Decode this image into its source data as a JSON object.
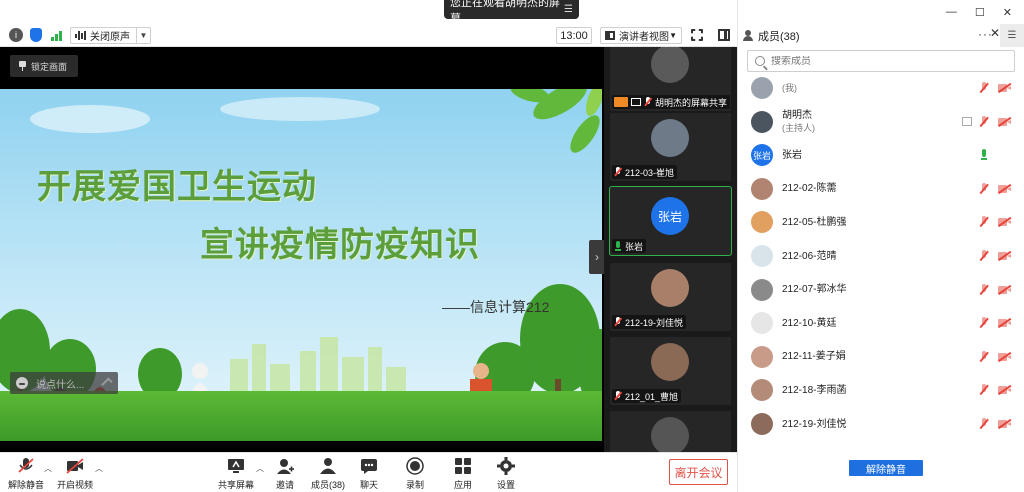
{
  "banner": {
    "viewing_text": "您正在观看胡明杰的屏幕"
  },
  "toolbar": {
    "audio_label": "关闭原声",
    "time": "13:00",
    "view_label": "演讲者视图"
  },
  "share": {
    "lock_label": "锁定画面",
    "slide_title_line1": "开展爱国卫生运动",
    "slide_title_line2": "宣讲疫情防疫知识",
    "slide_subtitle": "——信息计算212",
    "chat_placeholder": "说点什么..."
  },
  "thumbnails": [
    {
      "name": "胡明杰的屏幕共享",
      "audio": "muted",
      "sharing": true
    },
    {
      "name": "212-03-崔旭",
      "audio": "muted"
    },
    {
      "name": "张岩",
      "audio": "on",
      "initial": "张岩",
      "speaking": true
    },
    {
      "name": "212-19-刘佳悦",
      "audio": "muted"
    },
    {
      "name": "212_01_曹旭",
      "audio": "muted"
    }
  ],
  "bottom": {
    "unmute_label": "解除静音",
    "video_label": "开启视频",
    "share_label": "共享屏幕",
    "invite_label": "邀请",
    "members_label": "成员(38)",
    "chat_label": "聊天",
    "record_label": "录制",
    "apps_label": "应用",
    "settings_label": "设置",
    "leave_label": "离开会议"
  },
  "panel": {
    "title": "成员(38)",
    "search_placeholder": "搜索成员",
    "unmute_all_label": "解除静音",
    "members": [
      {
        "name": "",
        "role": "(我)",
        "mic": "off",
        "cam": "off"
      },
      {
        "name": "胡明杰",
        "role": "(主持人)",
        "mic": "off",
        "cam": "off",
        "screen": true
      },
      {
        "name": "张岩",
        "role": "",
        "mic": "on",
        "cam": "none",
        "initial": "张岩"
      },
      {
        "name": "212-02-陈薷",
        "role": "",
        "mic": "off",
        "cam": "off"
      },
      {
        "name": "212-05-杜鹏强",
        "role": "",
        "mic": "off",
        "cam": "off"
      },
      {
        "name": "212-06-范晴",
        "role": "",
        "mic": "off",
        "cam": "off"
      },
      {
        "name": "212-07-郭冰华",
        "role": "",
        "mic": "off",
        "cam": "off"
      },
      {
        "name": "212-10-黄廷",
        "role": "",
        "mic": "off",
        "cam": "off"
      },
      {
        "name": "212-11-姜子娟",
        "role": "",
        "mic": "off",
        "cam": "off"
      },
      {
        "name": "212-18-李雨菡",
        "role": "",
        "mic": "off",
        "cam": "off"
      },
      {
        "name": "212-19-刘佳悦",
        "role": "",
        "mic": "off",
        "cam": "off"
      }
    ]
  },
  "colors": {
    "accent_blue": "#1e6fe0",
    "leave_red": "#e3524a",
    "speaking_green": "#2db34a",
    "slide_title_green": "#5c9e3c"
  }
}
